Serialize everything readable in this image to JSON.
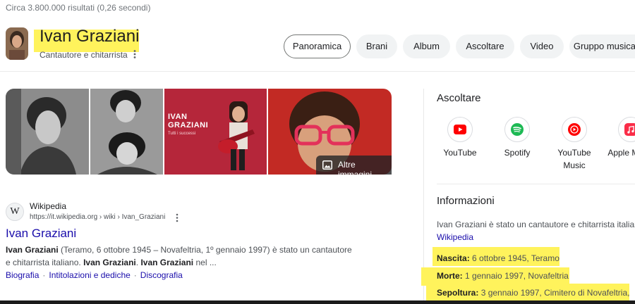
{
  "results_count": "Circa 3.800.000 risultati (0,26 secondi)",
  "entity": {
    "name": "Ivan Graziani",
    "subtitle": "Cantautore e chitarrista"
  },
  "tabs": [
    {
      "label": "Panoramica",
      "active": true
    },
    {
      "label": "Brani"
    },
    {
      "label": "Album"
    },
    {
      "label": "Ascoltare"
    },
    {
      "label": "Video"
    },
    {
      "label": "Gruppo musicale"
    }
  ],
  "images": {
    "album_cover_text": "IVAN GRAZIANI",
    "album_cover_subtext": "Tutti i successi",
    "more_label": "Altre immagini"
  },
  "result": {
    "site_name": "Wikipedia",
    "url": "https://it.wikipedia.org › wiki › Ivan_Graziani",
    "title": "Ivan Graziani",
    "snippet": {
      "b1": "Ivan Graziani",
      "t1": " (Teramo, 6 ottobre 1945 – Novafeltria, 1º gennaio 1997) è stato un cantautore e chitarrista italiano. ",
      "b2": "Ivan Graziani",
      "t2": ". ",
      "b3": "Ivan Graziani",
      "t3": " nel ..."
    },
    "sitelinks": [
      "Biografia",
      "Intitolazioni e dediche",
      "Discografia"
    ]
  },
  "panel": {
    "listen_title": "Ascoltare",
    "services": [
      {
        "name": "YouTube",
        "icon": "youtube-icon",
        "color": "#ff0000"
      },
      {
        "name": "Spotify",
        "icon": "spotify-icon",
        "color": "#1db954"
      },
      {
        "name": "YouTube Music",
        "icon": "youtube-music-icon",
        "color": "#ff0000"
      },
      {
        "name": "Apple Music",
        "icon": "apple-music-icon",
        "color": "#fa2d48"
      }
    ],
    "info_title": "Informazioni",
    "description": "Ivan Graziani è stato un cantautore e chitarrista italiano",
    "source": "Wikipedia",
    "facts": [
      {
        "label": "Nascita:",
        "value": "6 ottobre 1945, Teramo"
      },
      {
        "label": "Morte:",
        "value": "1 gennaio 1997, Novafeltria"
      },
      {
        "label": "Sepoltura:",
        "value": "3 gennaio 1997, Cimitero di Novafeltria,"
      }
    ]
  },
  "colors": {
    "highlight": "#fff35c",
    "link": "#1a0dab"
  }
}
